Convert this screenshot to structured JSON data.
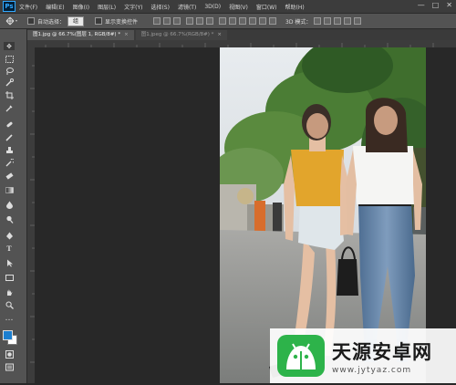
{
  "app": {
    "logo": "Ps"
  },
  "menu": [
    "文件(F)",
    "编辑(E)",
    "图像(I)",
    "图层(L)",
    "文字(Y)",
    "选择(S)",
    "滤镜(T)",
    "3D(D)",
    "视图(V)",
    "窗口(W)",
    "帮助(H)"
  ],
  "window_controls": [
    "—",
    "□",
    "✕"
  ],
  "options": {
    "auto_select_label": "自动选择：",
    "auto_select_value": "组",
    "show_transform_label": "显示变换控件",
    "mode_3d_label": "3D 模式："
  },
  "tabs": [
    {
      "label": "图1.jpg @ 66.7%(图层 1, RGB/8#) *",
      "close": "×"
    },
    {
      "label": "图1.jpeg @ 66.7%(RGB/8#) *",
      "close": "×"
    }
  ],
  "tools": [
    "move-tool",
    "marquee-tool",
    "lasso-tool",
    "quick-select-tool",
    "crop-tool",
    "eyedropper-tool",
    "healing-brush-tool",
    "brush-tool",
    "clone-stamp-tool",
    "history-brush-tool",
    "eraser-tool",
    "gradient-tool",
    "blur-tool",
    "dodge-tool",
    "pen-tool",
    "type-tool",
    "path-select-tool",
    "shape-tool",
    "hand-tool",
    "zoom-tool",
    "edit-toolbar-tool"
  ],
  "colors": {
    "foreground": "#1c7fd0",
    "background": "#ffffff",
    "accent": "#31a8ff",
    "watermark_green": "#2db34a"
  },
  "watermark": {
    "title": "天源安卓网",
    "url": "www.jytyaz.com"
  }
}
